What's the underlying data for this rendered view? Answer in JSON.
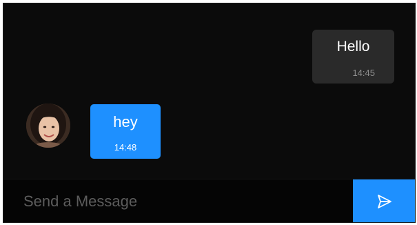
{
  "chat": {
    "messages": [
      {
        "direction": "sent",
        "text": "Hello",
        "time": "14:45"
      },
      {
        "direction": "received",
        "text": "hey",
        "time": "14:48",
        "avatar": "user-avatar"
      }
    ]
  },
  "composer": {
    "placeholder": "Send a Message",
    "value": "",
    "send_icon": "send-icon"
  },
  "colors": {
    "background": "#0b0b0b",
    "sent_bubble": "#2a2a2a",
    "received_bubble": "#1e90ff",
    "accent": "#1e90ff"
  }
}
